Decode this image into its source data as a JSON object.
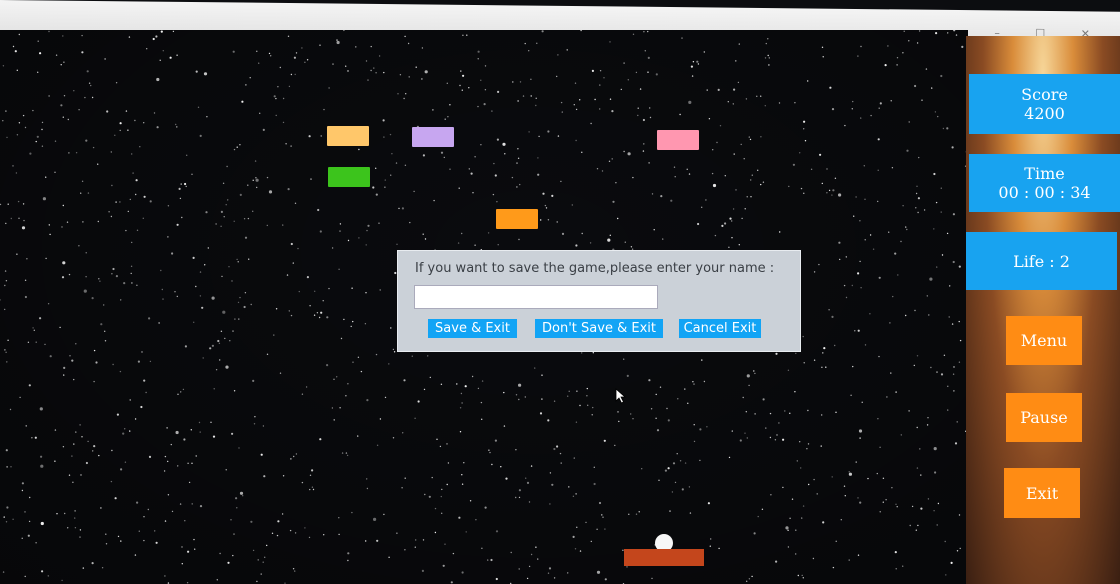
{
  "window": {
    "controls": "– ☐ ✕"
  },
  "stats": {
    "score_label": "Score",
    "score_value": "4200",
    "time_label": "Time",
    "time_value": "00 : 00 : 34",
    "life": "Life : 2"
  },
  "buttons": {
    "menu": "Menu",
    "pause": "Pause",
    "exit": "Exit"
  },
  "dialog": {
    "prompt": "If you want to save the game,please enter your name :",
    "input_value": "",
    "save_exit": "Save & Exit",
    "dont_save_exit": "Don't Save & Exit",
    "cancel_exit": "Cancel Exit"
  },
  "bricks": [
    {
      "color": "#ffc76a"
    },
    {
      "color": "#c7a6f0"
    },
    {
      "color": "#ff97b0"
    },
    {
      "color": "#3cc41c"
    },
    {
      "color": "#ff9a1a"
    }
  ],
  "colors": {
    "stat_panel": "#18a3f0",
    "orange_button": "#ff8c14",
    "paddle": "#c4461c",
    "dialog_bg": "#cbd1d8",
    "dialog_button": "#12a4f5"
  },
  "icons": {
    "cursor": "arrow-cursor-icon"
  }
}
